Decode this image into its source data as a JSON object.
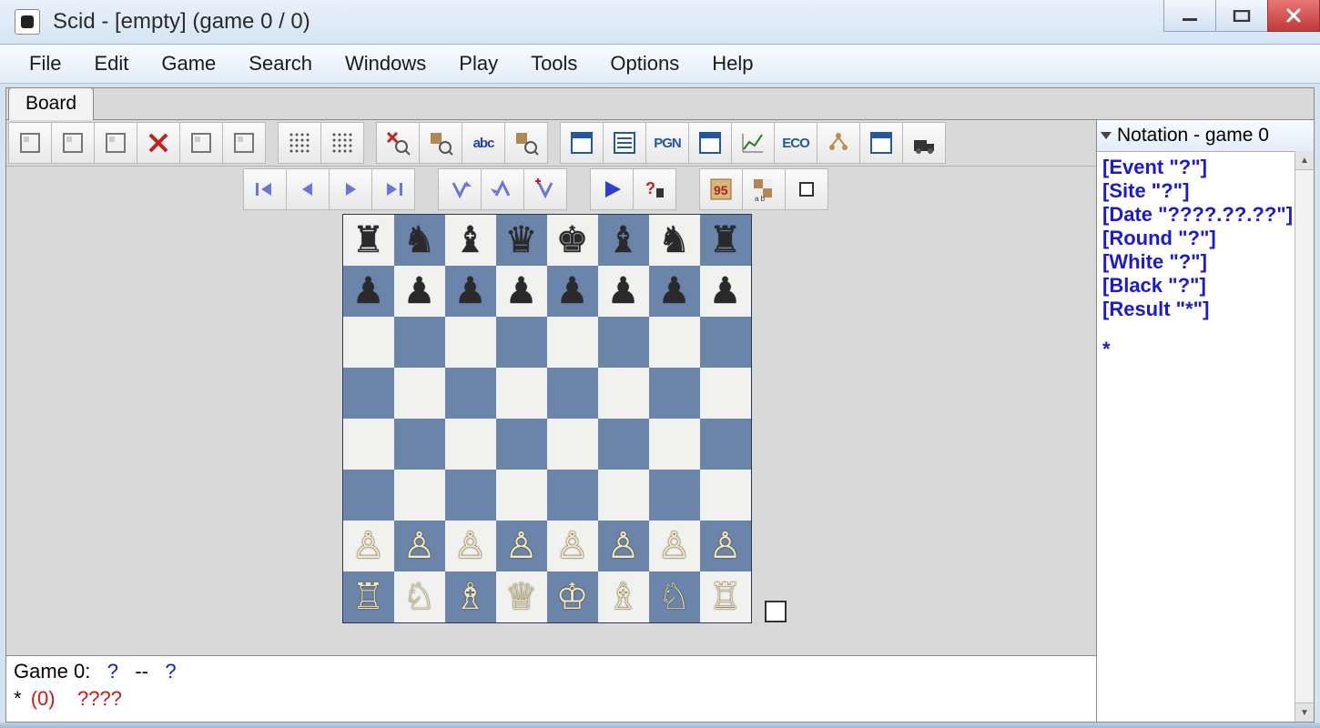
{
  "titlebar": {
    "title": "Scid - [empty] (game 0 / 0)"
  },
  "menu": {
    "items": [
      "File",
      "Edit",
      "Game",
      "Search",
      "Windows",
      "Play",
      "Tools",
      "Options",
      "Help"
    ]
  },
  "tabs": {
    "board": "Board"
  },
  "toolbar_main": [
    {
      "id": "new-game",
      "kind": "icon"
    },
    {
      "id": "open",
      "kind": "icon"
    },
    {
      "id": "save",
      "kind": "icon"
    },
    {
      "id": "cut",
      "kind": "x"
    },
    {
      "id": "print",
      "kind": "icon"
    },
    {
      "id": "flip",
      "kind": "icon"
    },
    {
      "sep": true
    },
    {
      "id": "dots-left",
      "kind": "dots"
    },
    {
      "id": "dots-right",
      "kind": "dots"
    },
    {
      "sep": true
    },
    {
      "id": "find-x",
      "kind": "xmag"
    },
    {
      "id": "find-board",
      "kind": "mag"
    },
    {
      "id": "find-abc",
      "kind": "abc",
      "label": "abc"
    },
    {
      "id": "find-fig",
      "kind": "mag"
    },
    {
      "sep": true
    },
    {
      "id": "panel-1",
      "kind": "panel",
      "accent": "#23579e"
    },
    {
      "id": "panel-list",
      "kind": "list",
      "accent": "#23579e"
    },
    {
      "id": "panel-pgn",
      "kind": "text",
      "label": "PGN",
      "accent": "#23579e"
    },
    {
      "id": "panel-4",
      "kind": "panel",
      "accent": "#23579e"
    },
    {
      "id": "panel-graph",
      "kind": "graph"
    },
    {
      "id": "panel-eco",
      "kind": "text",
      "label": "ECO",
      "accent": "#23579e"
    },
    {
      "id": "panel-tree",
      "kind": "tree"
    },
    {
      "id": "panel-8",
      "kind": "panel",
      "accent": "#23579e"
    },
    {
      "id": "panel-engine",
      "kind": "engine"
    }
  ],
  "toolbar_nav": [
    {
      "id": "nav-first",
      "glyph": "first"
    },
    {
      "id": "nav-prev",
      "glyph": "prev"
    },
    {
      "id": "nav-next",
      "glyph": "next"
    },
    {
      "id": "nav-last",
      "glyph": "last"
    },
    {
      "sepw": true
    },
    {
      "id": "var-down",
      "glyph": "vardown"
    },
    {
      "id": "var-up",
      "glyph": "varup"
    },
    {
      "id": "var-add",
      "glyph": "varadd"
    },
    {
      "sepw": true
    },
    {
      "id": "play",
      "glyph": "play"
    },
    {
      "id": "hint",
      "glyph": "hint"
    },
    {
      "sepw": true
    },
    {
      "id": "stamp",
      "glyph": "stamp"
    },
    {
      "id": "mini1",
      "glyph": "mini"
    },
    {
      "id": "mini2",
      "glyph": "miniempty"
    }
  ],
  "board": {
    "light": "#f1f1f0",
    "dark": "#6b85aa",
    "position": [
      [
        "r",
        "n",
        "b",
        "q",
        "k",
        "b",
        "n",
        "r"
      ],
      [
        "p",
        "p",
        "p",
        "p",
        "p",
        "p",
        "p",
        "p"
      ],
      [
        "",
        "",
        "",
        "",
        "",
        "",
        "",
        ""
      ],
      [
        "",
        "",
        "",
        "",
        "",
        "",
        "",
        ""
      ],
      [
        "",
        "",
        "",
        "",
        "",
        "",
        "",
        ""
      ],
      [
        "",
        "",
        "",
        "",
        "",
        "",
        "",
        ""
      ],
      [
        "P",
        "P",
        "P",
        "P",
        "P",
        "P",
        "P",
        "P"
      ],
      [
        "R",
        "N",
        "B",
        "Q",
        "K",
        "B",
        "N",
        "R"
      ]
    ]
  },
  "status": {
    "line1_game": "Game 0:",
    "line1_white": "?",
    "line1_sep": "--",
    "line1_black": "?",
    "line2_star": "*",
    "line2_paren": "(0)",
    "line2_date": "????"
  },
  "notation": {
    "title": "Notation - game 0",
    "tags": [
      "[Event \"?\"]",
      "[Site \"?\"]",
      "[Date \"????.??.??\"]",
      "[Round \"?\"]",
      "[White \"?\"]",
      "[Black \"?\"]",
      "[Result \"*\"]"
    ],
    "body_end": "*"
  }
}
